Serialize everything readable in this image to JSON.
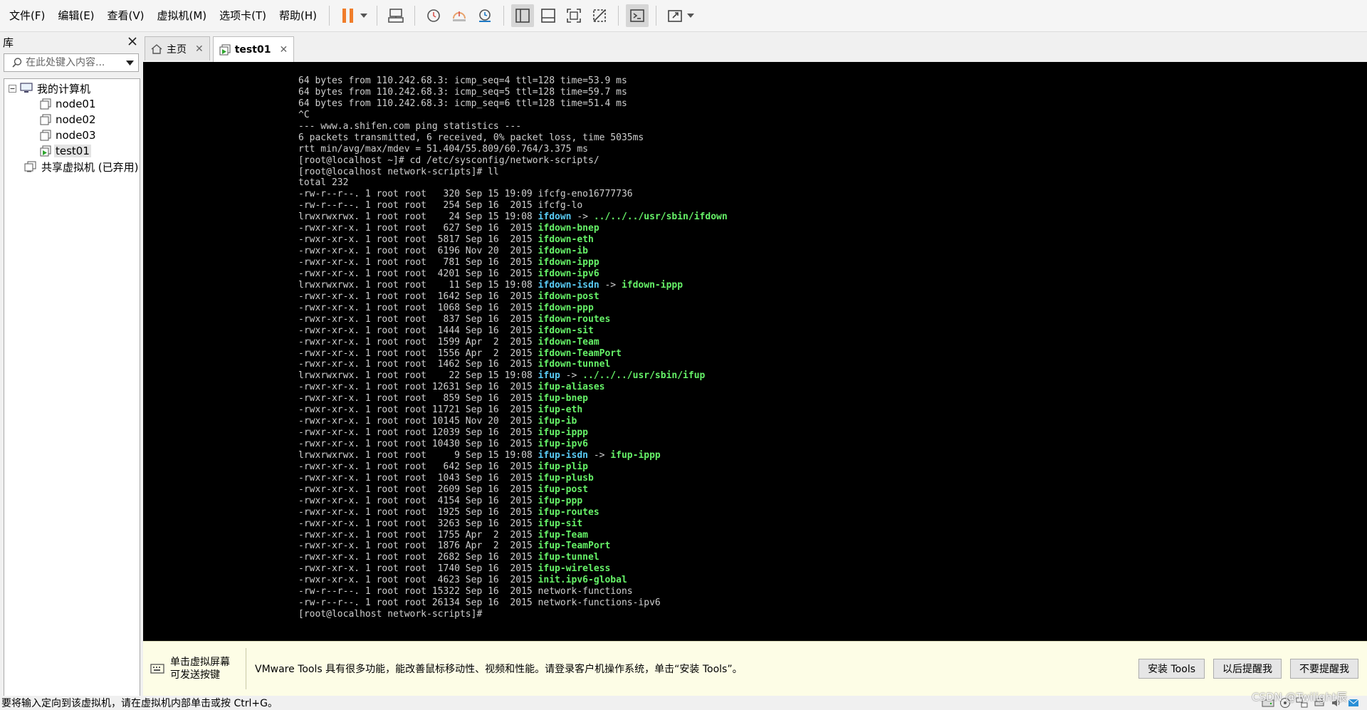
{
  "menu": [
    {
      "label": "文件(F)"
    },
    {
      "label": "编辑(E)"
    },
    {
      "label": "查看(V)"
    },
    {
      "label": "虚拟机(M)"
    },
    {
      "label": "选项卡(T)"
    },
    {
      "label": "帮助(H)"
    }
  ],
  "toolbar": {
    "icons": [
      "pause-icon",
      "send-keys-icon",
      "snapshot-icon",
      "revert-snapshot-icon",
      "snapshot-manager-icon",
      "library-view-icon",
      "thumbnail-bar-icon",
      "fullscreen-fit-icon",
      "unity-icon",
      "console-view-icon",
      "stretch-icon"
    ]
  },
  "library": {
    "title": "库",
    "search_placeholder": "在此处键入内容...",
    "tree": {
      "root": "我的计算机",
      "items": [
        "node01",
        "node02",
        "node03",
        "test01"
      ],
      "selected": "test01",
      "shared": "共享虚拟机 (已弃用)"
    }
  },
  "tabs": [
    {
      "label": "主页",
      "icon": "home-icon"
    },
    {
      "label": "test01",
      "icon": "vm-running-icon",
      "active": true
    }
  ],
  "console": {
    "lines": [
      [
        [
          "64 bytes from 110.242.68.3: icmp_seq=4 ttl=128 time=53.9 ms",
          "n"
        ]
      ],
      [
        [
          "64 bytes from 110.242.68.3: icmp_seq=5 ttl=128 time=59.7 ms",
          "n"
        ]
      ],
      [
        [
          "64 bytes from 110.242.68.3: icmp_seq=6 ttl=128 time=51.4 ms",
          "n"
        ]
      ],
      [
        [
          "^C",
          "n"
        ]
      ],
      [
        [
          "--- www.a.shifen.com ping statistics ---",
          "n"
        ]
      ],
      [
        [
          "6 packets transmitted, 6 received, 0% packet loss, time 5035ms",
          "n"
        ]
      ],
      [
        [
          "rtt min/avg/max/mdev = 51.404/55.809/60.764/3.375 ms",
          "n"
        ]
      ],
      [
        [
          "[root@localhost ~]# cd /etc/sysconfig/network-scripts/",
          "n"
        ]
      ],
      [
        [
          "[root@localhost network-scripts]# ll",
          "n"
        ]
      ],
      [
        [
          "total 232",
          "n"
        ]
      ],
      [
        [
          "-rw-r--r--. 1 root root   320 Sep 15 19:09 ",
          "n"
        ],
        [
          "ifcfg-eno16777736",
          "n"
        ]
      ],
      [
        [
          "-rw-r--r--. 1 root root   254 Sep 16  2015 ",
          "n"
        ],
        [
          "ifcfg-lo",
          "n"
        ]
      ],
      [
        [
          "lrwxrwxrwx. 1 root root    24 Sep 15 19:08 ",
          "n"
        ],
        [
          "ifdown",
          "c"
        ],
        [
          " -> ",
          "n"
        ],
        [
          "../../../usr/sbin/ifdown",
          "g"
        ]
      ],
      [
        [
          "-rwxr-xr-x. 1 root root   627 Sep 16  2015 ",
          "n"
        ],
        [
          "ifdown-bnep",
          "g"
        ]
      ],
      [
        [
          "-rwxr-xr-x. 1 root root  5817 Sep 16  2015 ",
          "n"
        ],
        [
          "ifdown-eth",
          "g"
        ]
      ],
      [
        [
          "-rwxr-xr-x. 1 root root  6196 Nov 20  2015 ",
          "n"
        ],
        [
          "ifdown-ib",
          "g"
        ]
      ],
      [
        [
          "-rwxr-xr-x. 1 root root   781 Sep 16  2015 ",
          "n"
        ],
        [
          "ifdown-ippp",
          "g"
        ]
      ],
      [
        [
          "-rwxr-xr-x. 1 root root  4201 Sep 16  2015 ",
          "n"
        ],
        [
          "ifdown-ipv6",
          "g"
        ]
      ],
      [
        [
          "lrwxrwxrwx. 1 root root    11 Sep 15 19:08 ",
          "n"
        ],
        [
          "ifdown-isdn",
          "c"
        ],
        [
          " -> ",
          "n"
        ],
        [
          "ifdown-ippp",
          "g"
        ]
      ],
      [
        [
          "-rwxr-xr-x. 1 root root  1642 Sep 16  2015 ",
          "n"
        ],
        [
          "ifdown-post",
          "g"
        ]
      ],
      [
        [
          "-rwxr-xr-x. 1 root root  1068 Sep 16  2015 ",
          "n"
        ],
        [
          "ifdown-ppp",
          "g"
        ]
      ],
      [
        [
          "-rwxr-xr-x. 1 root root   837 Sep 16  2015 ",
          "n"
        ],
        [
          "ifdown-routes",
          "g"
        ]
      ],
      [
        [
          "-rwxr-xr-x. 1 root root  1444 Sep 16  2015 ",
          "n"
        ],
        [
          "ifdown-sit",
          "g"
        ]
      ],
      [
        [
          "-rwxr-xr-x. 1 root root  1599 Apr  2  2015 ",
          "n"
        ],
        [
          "ifdown-Team",
          "g"
        ]
      ],
      [
        [
          "-rwxr-xr-x. 1 root root  1556 Apr  2  2015 ",
          "n"
        ],
        [
          "ifdown-TeamPort",
          "g"
        ]
      ],
      [
        [
          "-rwxr-xr-x. 1 root root  1462 Sep 16  2015 ",
          "n"
        ],
        [
          "ifdown-tunnel",
          "g"
        ]
      ],
      [
        [
          "lrwxrwxrwx. 1 root root    22 Sep 15 19:08 ",
          "n"
        ],
        [
          "ifup",
          "c"
        ],
        [
          " -> ",
          "n"
        ],
        [
          "../../../usr/sbin/ifup",
          "g"
        ]
      ],
      [
        [
          "-rwxr-xr-x. 1 root root 12631 Sep 16  2015 ",
          "n"
        ],
        [
          "ifup-aliases",
          "g"
        ]
      ],
      [
        [
          "-rwxr-xr-x. 1 root root   859 Sep 16  2015 ",
          "n"
        ],
        [
          "ifup-bnep",
          "g"
        ]
      ],
      [
        [
          "-rwxr-xr-x. 1 root root 11721 Sep 16  2015 ",
          "n"
        ],
        [
          "ifup-eth",
          "g"
        ]
      ],
      [
        [
          "-rwxr-xr-x. 1 root root 10145 Nov 20  2015 ",
          "n"
        ],
        [
          "ifup-ib",
          "g"
        ]
      ],
      [
        [
          "-rwxr-xr-x. 1 root root 12039 Sep 16  2015 ",
          "n"
        ],
        [
          "ifup-ippp",
          "g"
        ]
      ],
      [
        [
          "-rwxr-xr-x. 1 root root 10430 Sep 16  2015 ",
          "n"
        ],
        [
          "ifup-ipv6",
          "g"
        ]
      ],
      [
        [
          "lrwxrwxrwx. 1 root root     9 Sep 15 19:08 ",
          "n"
        ],
        [
          "ifup-isdn",
          "c"
        ],
        [
          " -> ",
          "n"
        ],
        [
          "ifup-ippp",
          "g"
        ]
      ],
      [
        [
          "-rwxr-xr-x. 1 root root   642 Sep 16  2015 ",
          "n"
        ],
        [
          "ifup-plip",
          "g"
        ]
      ],
      [
        [
          "-rwxr-xr-x. 1 root root  1043 Sep 16  2015 ",
          "n"
        ],
        [
          "ifup-plusb",
          "g"
        ]
      ],
      [
        [
          "-rwxr-xr-x. 1 root root  2609 Sep 16  2015 ",
          "n"
        ],
        [
          "ifup-post",
          "g"
        ]
      ],
      [
        [
          "-rwxr-xr-x. 1 root root  4154 Sep 16  2015 ",
          "n"
        ],
        [
          "ifup-ppp",
          "g"
        ]
      ],
      [
        [
          "-rwxr-xr-x. 1 root root  1925 Sep 16  2015 ",
          "n"
        ],
        [
          "ifup-routes",
          "g"
        ]
      ],
      [
        [
          "-rwxr-xr-x. 1 root root  3263 Sep 16  2015 ",
          "n"
        ],
        [
          "ifup-sit",
          "g"
        ]
      ],
      [
        [
          "-rwxr-xr-x. 1 root root  1755 Apr  2  2015 ",
          "n"
        ],
        [
          "ifup-Team",
          "g"
        ]
      ],
      [
        [
          "-rwxr-xr-x. 1 root root  1876 Apr  2  2015 ",
          "n"
        ],
        [
          "ifup-TeamPort",
          "g"
        ]
      ],
      [
        [
          "-rwxr-xr-x. 1 root root  2682 Sep 16  2015 ",
          "n"
        ],
        [
          "ifup-tunnel",
          "g"
        ]
      ],
      [
        [
          "-rwxr-xr-x. 1 root root  1740 Sep 16  2015 ",
          "n"
        ],
        [
          "ifup-wireless",
          "g"
        ]
      ],
      [
        [
          "-rwxr-xr-x. 1 root root  4623 Sep 16  2015 ",
          "n"
        ],
        [
          "init.ipv6-global",
          "g"
        ]
      ],
      [
        [
          "-rw-r--r--. 1 root root 15322 Sep 16  2015 ",
          "n"
        ],
        [
          "network-functions",
          "n"
        ]
      ],
      [
        [
          "-rw-r--r--. 1 root root 26134 Sep 16  2015 ",
          "n"
        ],
        [
          "network-functions-ipv6",
          "n"
        ]
      ],
      [
        [
          "[root@localhost network-scripts]# ",
          "n"
        ]
      ]
    ]
  },
  "notification": {
    "hint": "单击虚拟屏幕\n可发送按键",
    "message": "VMware Tools 具有很多功能，能改善鼠标移动性、视频和性能。请登录客户机操作系统，单击“安装 Tools”。",
    "buttons": [
      "安装 Tools",
      "以后提醒我",
      "不要提醒我"
    ]
  },
  "statusbar": {
    "text": "要将输入定向到该虚拟机，请在虚拟机内部单击或按 Ctrl+G。",
    "icons": [
      "hard-disk-icon",
      "cd-icon",
      "network-icon",
      "printer-icon",
      "sound-icon",
      "message-icon"
    ]
  },
  "watermark": "CSDN @Twilight辰",
  "colors": {
    "accent_pause": "#f07d2a",
    "console_bg": "#000000",
    "term_cyan": "#59cbf5",
    "term_green": "#66f268"
  }
}
